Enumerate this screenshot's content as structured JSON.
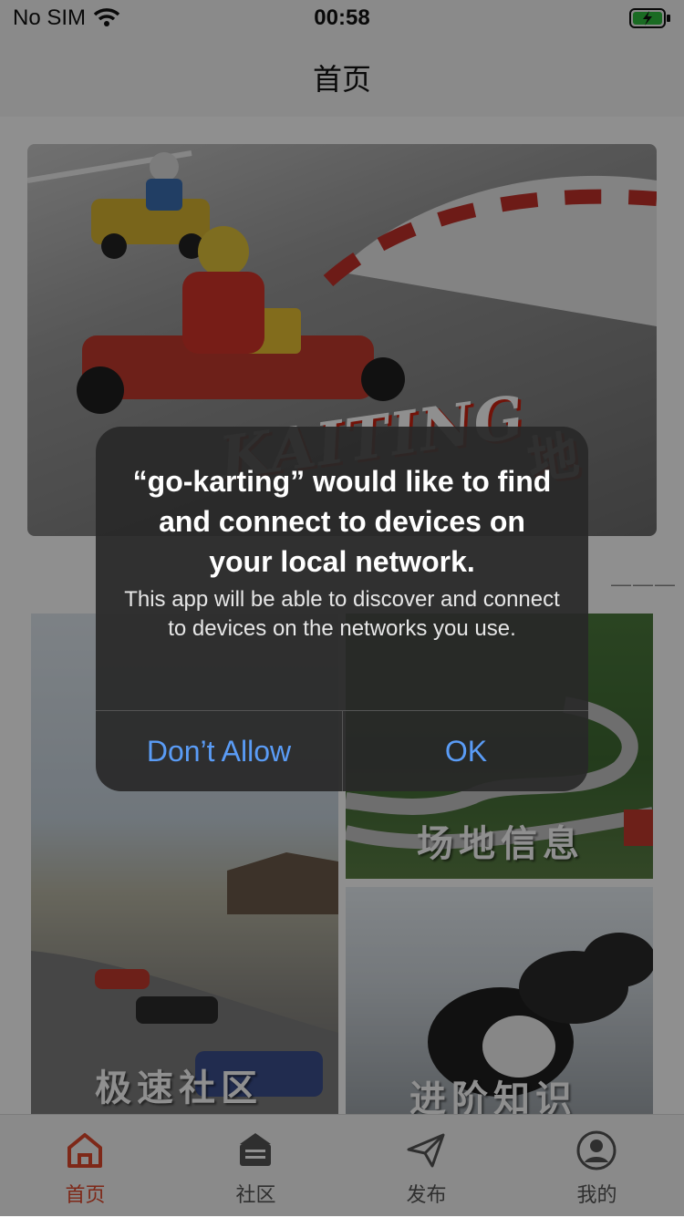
{
  "status_bar": {
    "carrier": "No SIM",
    "time": "00:58"
  },
  "nav": {
    "title": "首页"
  },
  "hero": {
    "text": "KAITING",
    "text_cn": "地"
  },
  "section": {
    "dashes": "———"
  },
  "cards": [
    {
      "label": "极速社区"
    },
    {
      "label": "场地信息"
    },
    {
      "label": "进阶知识"
    }
  ],
  "tabs": [
    {
      "label": "首页",
      "icon": "home-icon",
      "active": true
    },
    {
      "label": "社区",
      "icon": "community-icon",
      "active": false
    },
    {
      "label": "发布",
      "icon": "send-icon",
      "active": false
    },
    {
      "label": "我的",
      "icon": "profile-icon",
      "active": false
    }
  ],
  "alert": {
    "title": "“go-karting” would like to find and connect to devices on your local network.",
    "message": "This app will be able to discover and connect to devices on the networks you use.",
    "deny_label": "Don’t Allow",
    "ok_label": "OK"
  },
  "colors": {
    "accent": "#e0482b",
    "alert_button": "#5a9cf6"
  }
}
